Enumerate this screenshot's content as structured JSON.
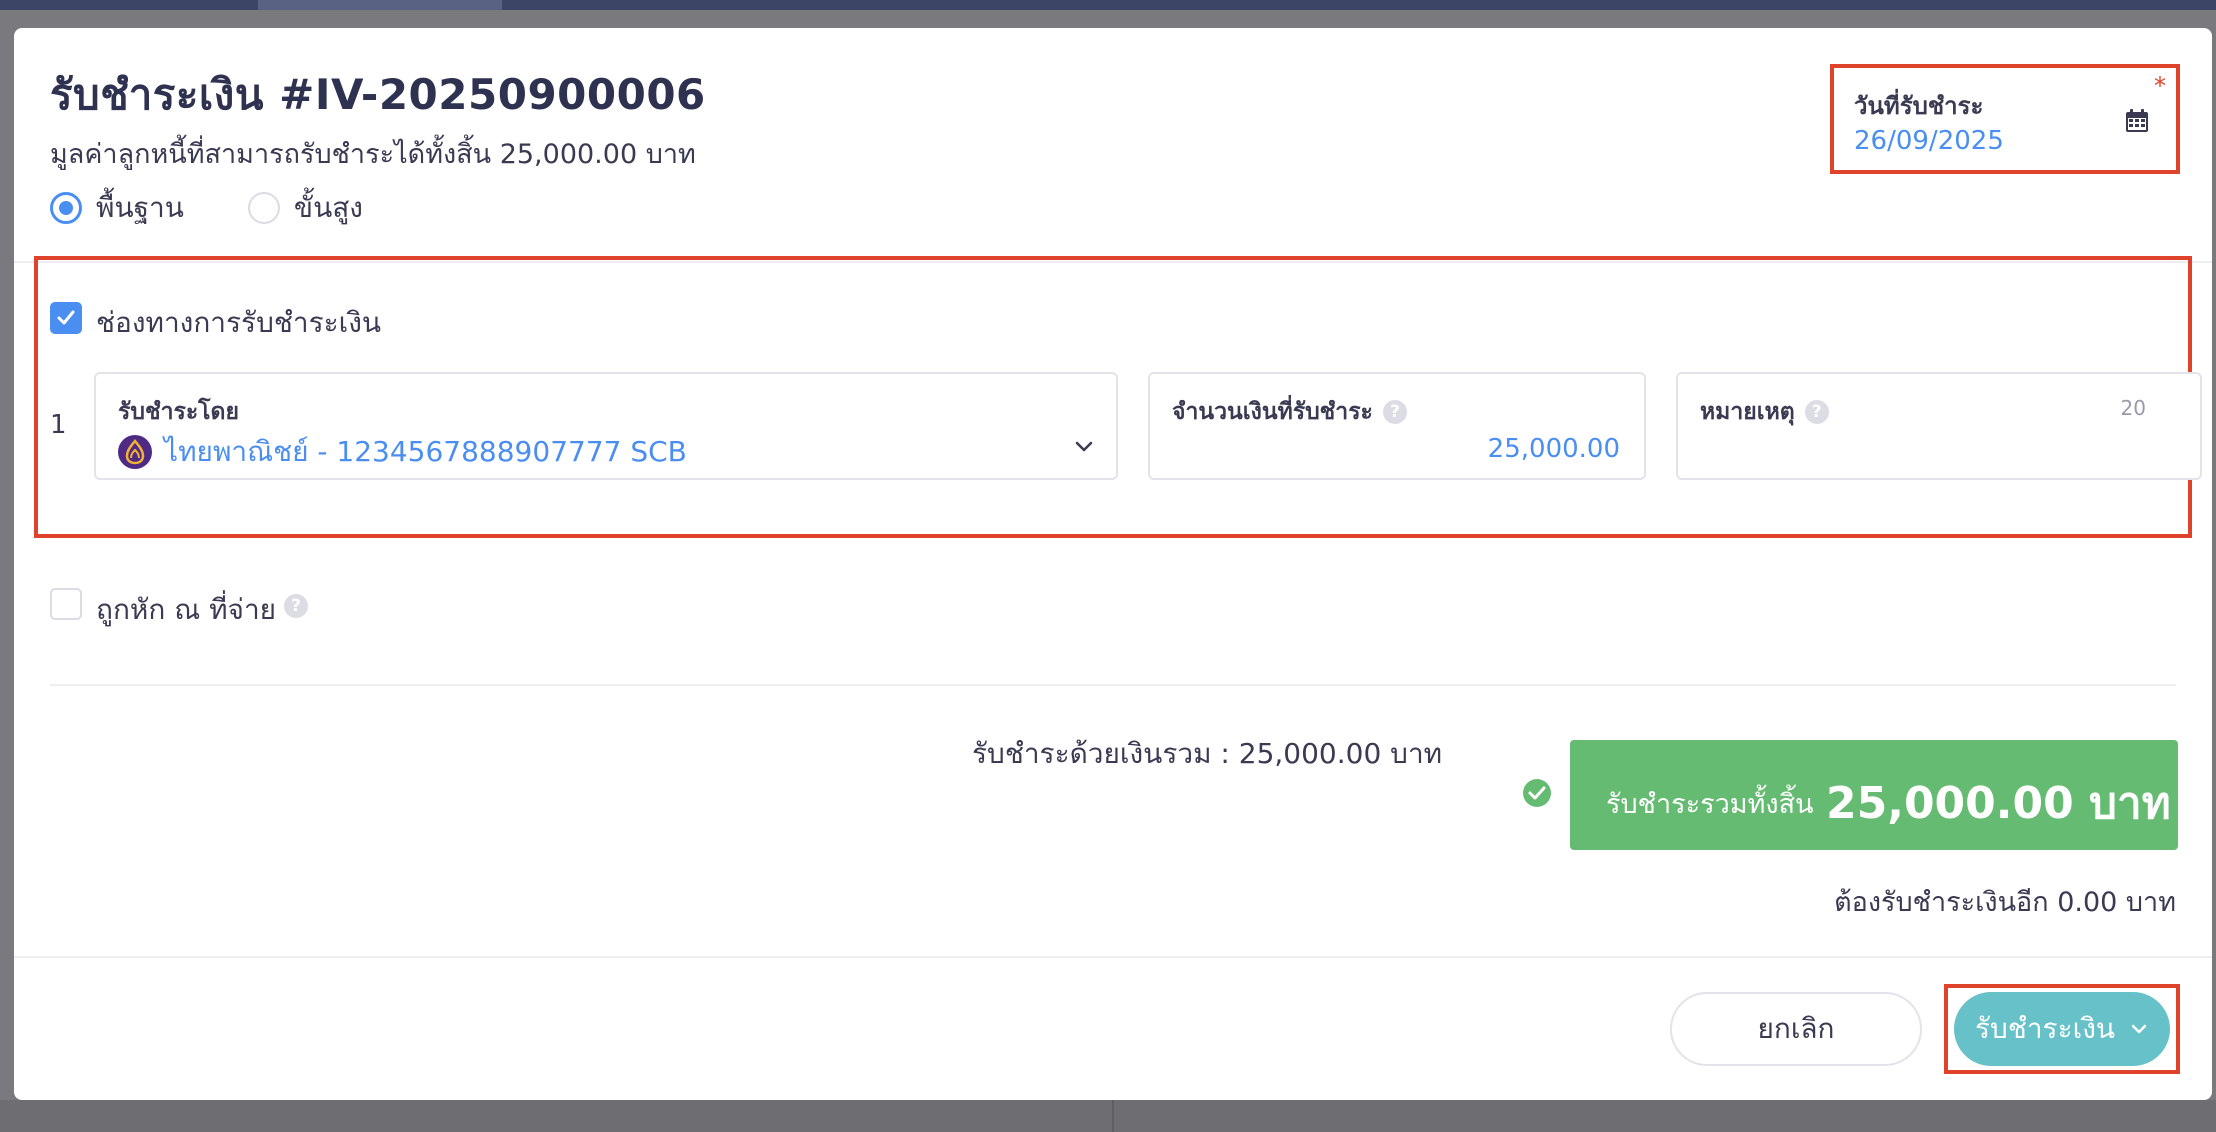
{
  "title": "รับชำระเงิน #IV-20250900006",
  "subtitle": "มูลค่าลูกหนี้ที่สามารถรับชำระได้ทั้งสิ้น 25,000.00 บาท",
  "mode": {
    "options": [
      {
        "label": "พื้นฐาน",
        "selected": true
      },
      {
        "label": "ขั้นสูง",
        "selected": false
      }
    ]
  },
  "payment_date": {
    "label": "วันที่รับชำระ",
    "required_mark": "*",
    "value": "26/09/2025",
    "icon": "calendar-icon"
  },
  "payment_channel": {
    "enabled": true,
    "label": "ช่องทางการรับชำระเงิน",
    "rows": [
      {
        "index": "1",
        "received_by_label": "รับชำระโดย",
        "received_by_value": "ไทยพาณิชย์ - 1234567888907777 SCB",
        "amount_label": "จำนวนเงินที่รับชำระ",
        "amount_value": "25,000.00",
        "note_label": "หมายเหตุ",
        "note_counter": "20",
        "note_value": ""
      }
    ]
  },
  "withholding": {
    "enabled": false,
    "label": "ถูกหัก ณ ที่จ่าย"
  },
  "summary": {
    "paid_total_text": "รับชำระด้วยเงินรวม :  25,000.00 บาท",
    "grand_total_label": "รับชำระรวมทั้งสิ้น",
    "grand_total_value": "25,000.00 บาท",
    "remaining_text": "ต้องรับชำระเงินอีก 0.00 บาท"
  },
  "footer": {
    "cancel_label": "ยกเลิก",
    "submit_label": "รับชำระเงิน"
  },
  "colors": {
    "accent": "#4a8ef2",
    "success": "#65bb72",
    "submit": "#66c1c9",
    "highlight": "#e0432c"
  }
}
